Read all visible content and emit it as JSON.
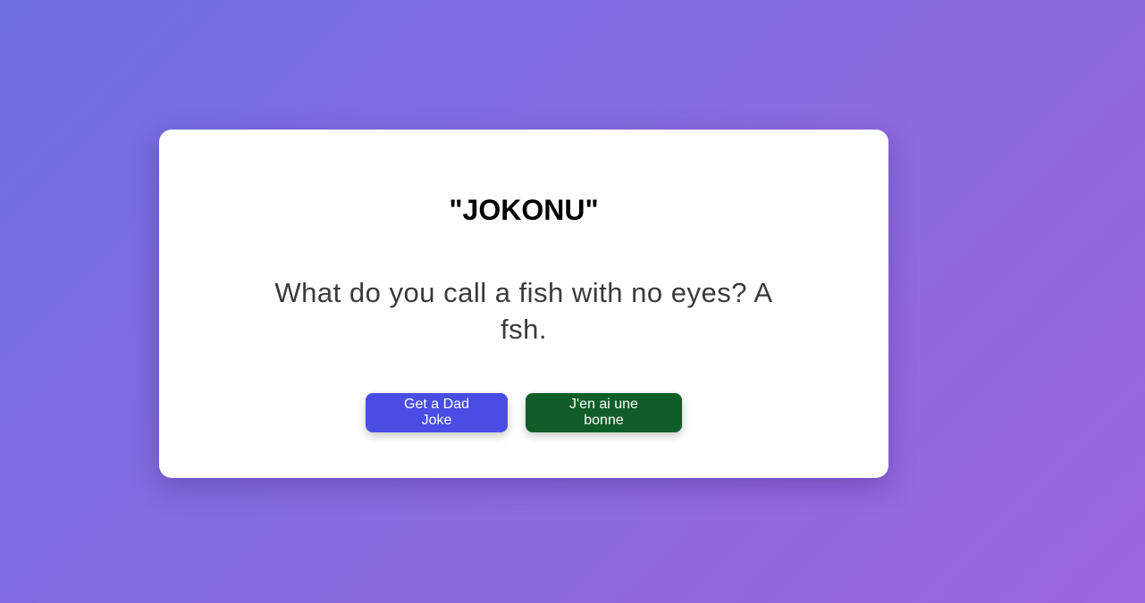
{
  "card": {
    "title": "\"JOKONU\"",
    "joke": "What do you call a fish with no eyes? A fsh.",
    "buttons": {
      "get_joke": "Get a Dad Joke",
      "submit_joke": "J'en ai une bonne"
    }
  },
  "colors": {
    "background_start": "#6e6ee0",
    "background_end": "#9c66de",
    "primary_button": "#4a4de3",
    "secondary_button": "#0f5e28",
    "card": "#ffffff"
  }
}
